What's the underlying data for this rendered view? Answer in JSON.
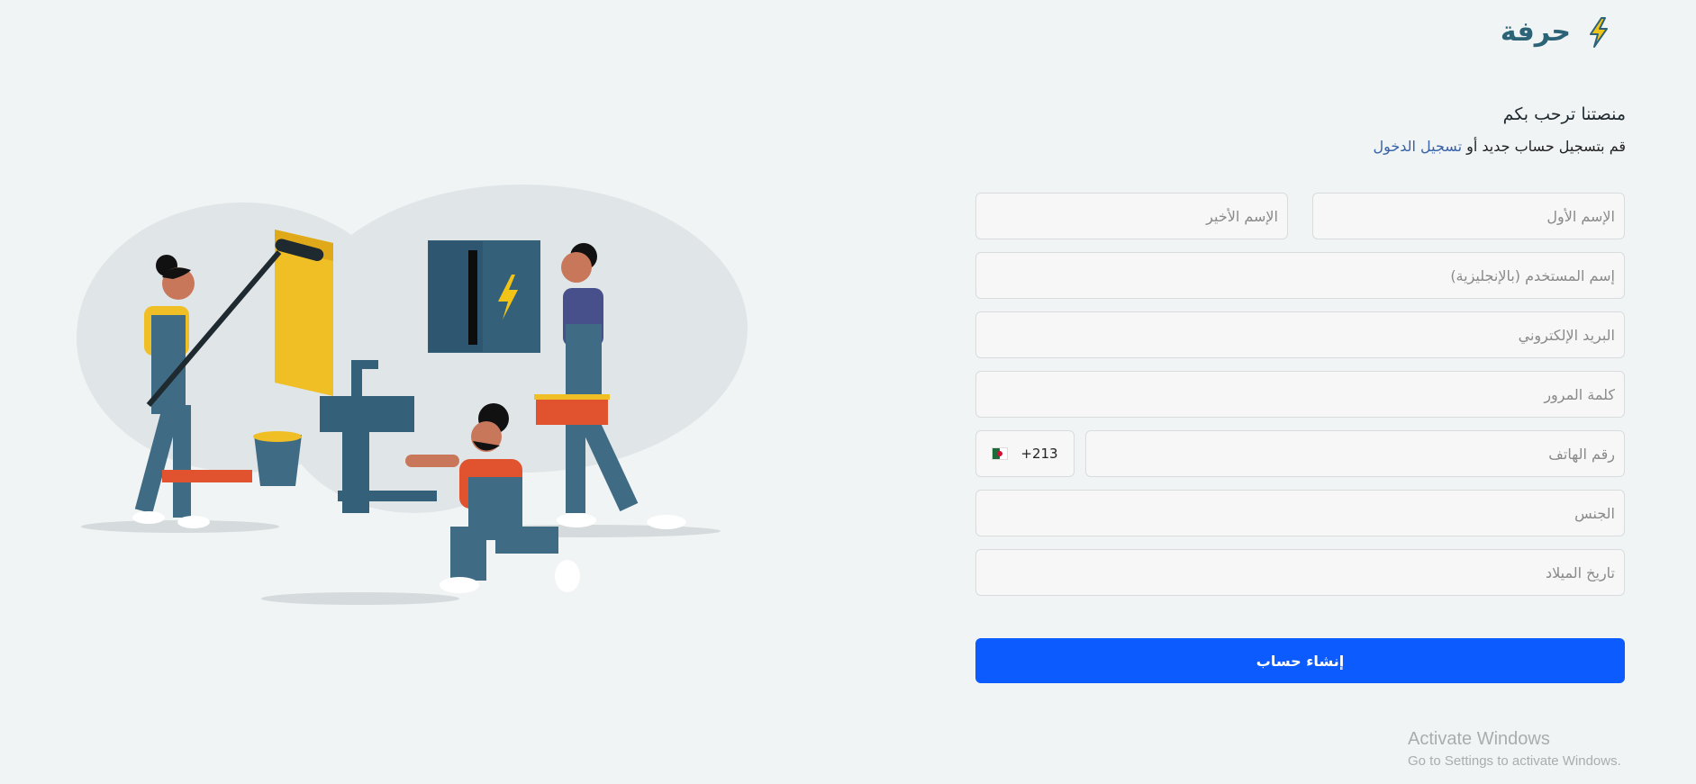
{
  "brand": {
    "name": "حرفة",
    "icon": "lightning-bolt-icon"
  },
  "header": {
    "welcome": "منصتنا ترحب بكم",
    "subtitle_prefix": "قم بتسجيل حساب جديد أو ",
    "login_link": "تسجيل الدخول"
  },
  "form": {
    "first_name_placeholder": "الإسم الأول",
    "last_name_placeholder": "الإسم الأخير",
    "username_placeholder": "إسم المستخدم (بالإنجليزية)",
    "email_placeholder": "البريد الإلكتروني",
    "password_placeholder": "كلمة المرور",
    "phone_placeholder": "رقم الهاتف",
    "country_code": "+213",
    "gender_placeholder": "الجنس",
    "birthdate_placeholder": "تاريخ الميلاد",
    "submit_label": "إنشاء حساب"
  },
  "watermark": {
    "line1": "Activate Windows",
    "line2": "Go to Settings to activate Windows."
  },
  "colors": {
    "accent": "#0b5bff",
    "brand": "#2d6376",
    "link": "#3862a8",
    "background": "#f0f4f4"
  }
}
